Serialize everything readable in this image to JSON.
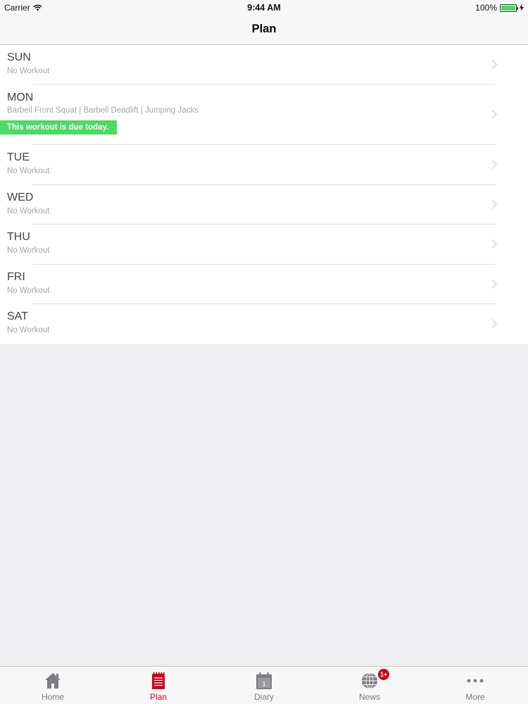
{
  "status_bar": {
    "carrier": "Carrier",
    "time": "9:44 AM",
    "battery": "100%",
    "battery_level": 1.0
  },
  "nav": {
    "title": "Plan"
  },
  "days": [
    {
      "day": "SUN",
      "subtitle": "No Workout"
    },
    {
      "day": "MON",
      "subtitle": "Barbell Front Squat | Barbell Deadlift | Jumping Jacks",
      "badge": "This workout is due today."
    },
    {
      "day": "TUE",
      "subtitle": "No Workout"
    },
    {
      "day": "WED",
      "subtitle": "No Workout"
    },
    {
      "day": "THU",
      "subtitle": "No Workout"
    },
    {
      "day": "FRI",
      "subtitle": "No Workout"
    },
    {
      "day": "SAT",
      "subtitle": "No Workout"
    }
  ],
  "tabs": [
    {
      "label": "Home",
      "icon": "home-icon"
    },
    {
      "label": "Plan",
      "icon": "plan-notepad-icon",
      "active": true
    },
    {
      "label": "Diary",
      "icon": "calendar-icon",
      "calendar_day": "1"
    },
    {
      "label": "News",
      "icon": "globe-icon",
      "badge": "1+"
    },
    {
      "label": "More",
      "icon": "more-dots-icon"
    }
  ],
  "colors": {
    "accent": "#d0021b",
    "due_badge": "#4cd964",
    "background": "#efeff1"
  }
}
